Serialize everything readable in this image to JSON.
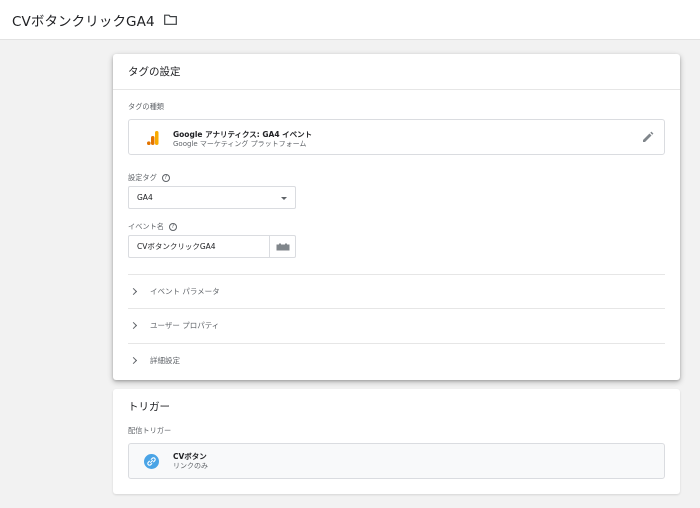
{
  "header": {
    "title": "CVボタンクリックGA4",
    "folder_icon": "folder-icon"
  },
  "tag_config": {
    "title": "タグの設定",
    "type_label": "タグの種類",
    "type_name": "Google アナリティクス: GA4 イベント",
    "type_vendor": "Google マーケティング プラットフォーム",
    "config_tag_label": "設定タグ",
    "config_tag_value": "GA4",
    "event_name_label": "イベント名",
    "event_name_value": "CVボタンクリックGA4",
    "sections": [
      "イベント パラメータ",
      "ユーザー プロパティ",
      "詳細設定"
    ],
    "help_glyph": "?"
  },
  "trigger": {
    "title": "トリガー",
    "firing_label": "配信トリガー",
    "name": "CVボタン",
    "type": "リンクのみ"
  },
  "colors": {
    "ga_orange": "#f9ab00",
    "ga_dark_orange": "#e37400",
    "link_blue": "#4aa4e6"
  }
}
